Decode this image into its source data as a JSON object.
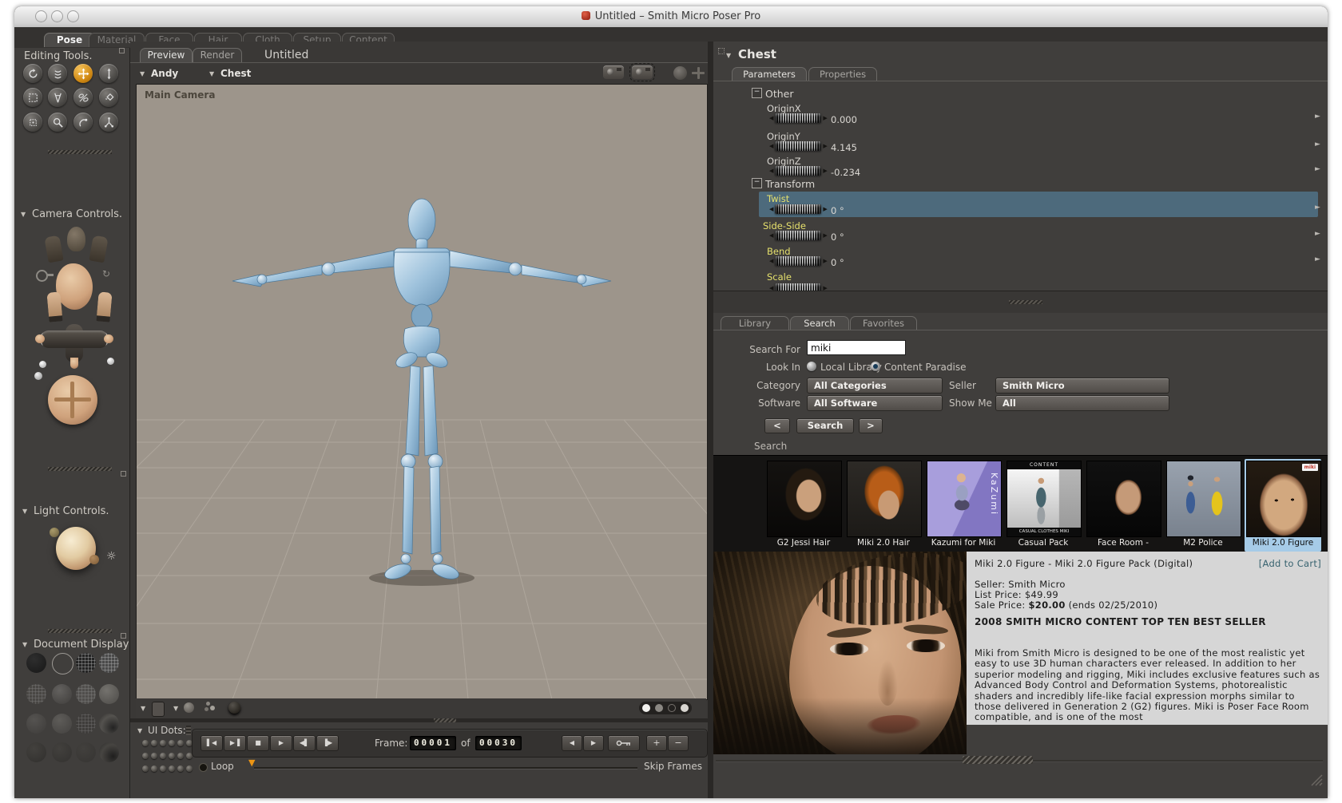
{
  "window": {
    "title": "Untitled – Smith Micro Poser Pro"
  },
  "room_tabs": {
    "active": "Pose",
    "items": [
      {
        "label": "Pose"
      },
      {
        "label": "Material"
      },
      {
        "label": "Face"
      },
      {
        "label": "Hair"
      },
      {
        "label": "Cloth"
      },
      {
        "label": "Setup"
      },
      {
        "label": "Content"
      }
    ]
  },
  "left_panel": {
    "editing_tools_title": "Editing Tools.",
    "tools": [
      "rotate",
      "twist",
      "translate-pull",
      "translate-in-out",
      "scale",
      "taper",
      "chain-break",
      "color",
      "grouping",
      "view-magnifier",
      "morphing-tool",
      "direct-manipulation"
    ],
    "active_tool": "translate-pull",
    "camera_controls_title": "Camera Controls.",
    "light_controls_title": "Light Controls.",
    "document_display_title": "Document Display",
    "ui_dots_title": "UI Dots:"
  },
  "document_window": {
    "tabs": {
      "preview": "Preview",
      "render": "Render"
    },
    "title": "Untitled",
    "figure_menu": "Andy",
    "actor_menu": "Chest",
    "camera_label": "Main Camera"
  },
  "timeline": {
    "frame_label": "Frame:",
    "frame_current": "00001",
    "of_label": "of",
    "frame_total": "00030",
    "loop_label": "Loop",
    "skip_frames_label": "Skip Frames",
    "transport": {
      "first": "▌◀",
      "last": "▶▐",
      "stop": "■",
      "play": "▶",
      "step_back": "◀▌",
      "step_fwd": "▐▶",
      "prev": "◀",
      "next": "▶",
      "plus": "+",
      "minus": "−"
    }
  },
  "parameters": {
    "actor": "Chest",
    "tabs": {
      "parameters": "Parameters",
      "properties": "Properties"
    },
    "selected_row": "Twist",
    "groups": {
      "other": {
        "label": "Other",
        "rows": [
          {
            "label": "OriginX",
            "value": "0.000"
          },
          {
            "label": "OriginY",
            "value": "4.145"
          },
          {
            "label": "OriginZ",
            "value": "-0.234"
          }
        ]
      },
      "transform": {
        "label": "Transform",
        "rows": [
          {
            "label": "Twist",
            "value": "0 °"
          },
          {
            "label": "Side-Side",
            "value": "0 °"
          },
          {
            "label": "Bend",
            "value": "0 °"
          },
          {
            "label": "Scale",
            "value": ""
          }
        ]
      }
    }
  },
  "library": {
    "tabs": {
      "library": "Library",
      "search": "Search",
      "favorites": "Favorites"
    },
    "active_tab": "Search",
    "form": {
      "search_for_label": "Search For",
      "search_value": "miki",
      "look_in_label": "Look In",
      "radio_local": "Local Library",
      "radio_paradise": "Content Paradise",
      "selected_radio": "Content Paradise",
      "category_label": "Category",
      "category_value": "All Categories",
      "seller_label": "Seller",
      "seller_value": "Smith Micro",
      "software_label": "Software",
      "software_value": "All Software",
      "show_me_label": "Show Me",
      "show_me_value": "All",
      "prev_button": "<",
      "search_button": "Search",
      "next_button": ">"
    },
    "results_section_label": "Search",
    "results": [
      {
        "label": "G2 Jessi Hair"
      },
      {
        "label": "Miki 2.0 Hair"
      },
      {
        "label": "Kazumi for Miki",
        "overlay": "KaZumi"
      },
      {
        "label": "Casual Pack",
        "header": "CONTENT",
        "footer": "CASUAL CLOTHES MIKI"
      },
      {
        "label": "Face Room -"
      },
      {
        "label": "M2 Police"
      },
      {
        "label": "Miki 2.0 Figure",
        "badge": "miki",
        "selected": true
      }
    ]
  },
  "product": {
    "title": "Miki 2.0 Figure - Miki 2.0 Figure Pack (Digital)",
    "add_to_cart": "[Add to Cart]",
    "seller": "Seller: Smith Micro",
    "list_price": "List Price: $49.99",
    "sale_price_label": "Sale Price:",
    "sale_price_value": "$20.00",
    "sale_price_note": "(ends 02/25/2010)",
    "badge": "2008 SMITH MICRO CONTENT TOP TEN BEST SELLER",
    "description": "Miki from Smith Micro is designed to be one of the most realistic yet easy to use 3D human characters ever released. In addition to her superior modeling and rigging, Miki includes exclusive features such as Advanced Body Control and Deformation Systems, photorealistic shaders and incredibly life-like facial expression morphs similar to those delivered in Generation 2 (G2) figures. Miki is Poser Face Room compatible, and is one of the most"
  }
}
